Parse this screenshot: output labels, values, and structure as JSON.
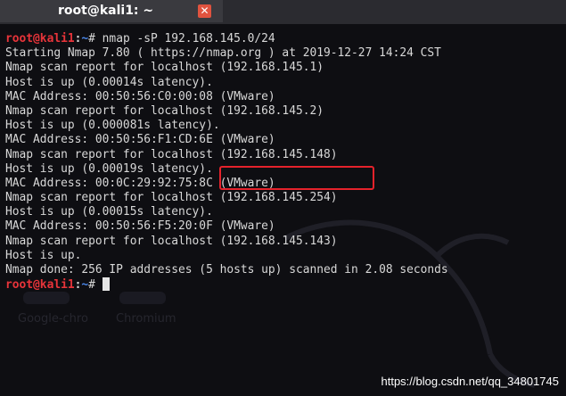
{
  "tab": {
    "title": "root@kali1: ~",
    "close_glyph": "✕",
    "close_icon": "close-icon"
  },
  "prompt": {
    "user_host": "root@kali1",
    "separator": ":",
    "path": "~",
    "symbol": "# "
  },
  "command": "nmap -sP 192.168.145.0/24",
  "output_lines": [
    "Starting Nmap 7.80 ( https://nmap.org ) at 2019-12-27 14:24 CST",
    "Nmap scan report for localhost (192.168.145.1)",
    "Host is up (0.00014s latency).",
    "MAC Address: 00:50:56:C0:00:08 (VMware)",
    "Nmap scan report for localhost (192.168.145.2)",
    "Host is up (0.000081s latency).",
    "MAC Address: 00:50:56:F1:CD:6E (VMware)",
    "Nmap scan report for localhost (192.168.145.148)",
    "Host is up (0.00019s latency).",
    "MAC Address: 00:0C:29:92:75:8C (VMware)",
    "Nmap scan report for localhost (192.168.145.254)",
    "Host is up (0.00015s latency).",
    "MAC Address: 00:50:56:F5:20:0F (VMware)",
    "Nmap scan report for localhost (192.168.145.143)",
    "Host is up.",
    "Nmap done: 256 IP addresses (5 hosts up) scanned in 2.08 seconds"
  ],
  "highlighted_text": "(192.168.145.148)",
  "desktop_ghost_labels": [
    "Google-chro",
    "Chromium"
  ],
  "watermark": "https://blog.csdn.net/qq_34801745",
  "colors": {
    "prompt_user": "#e8343a",
    "prompt_path": "#4a86e8",
    "terminal_text": "#d8d8d8",
    "highlight_box": "#e5222b",
    "close_button": "#e0533f",
    "background": "#0e0e12"
  }
}
